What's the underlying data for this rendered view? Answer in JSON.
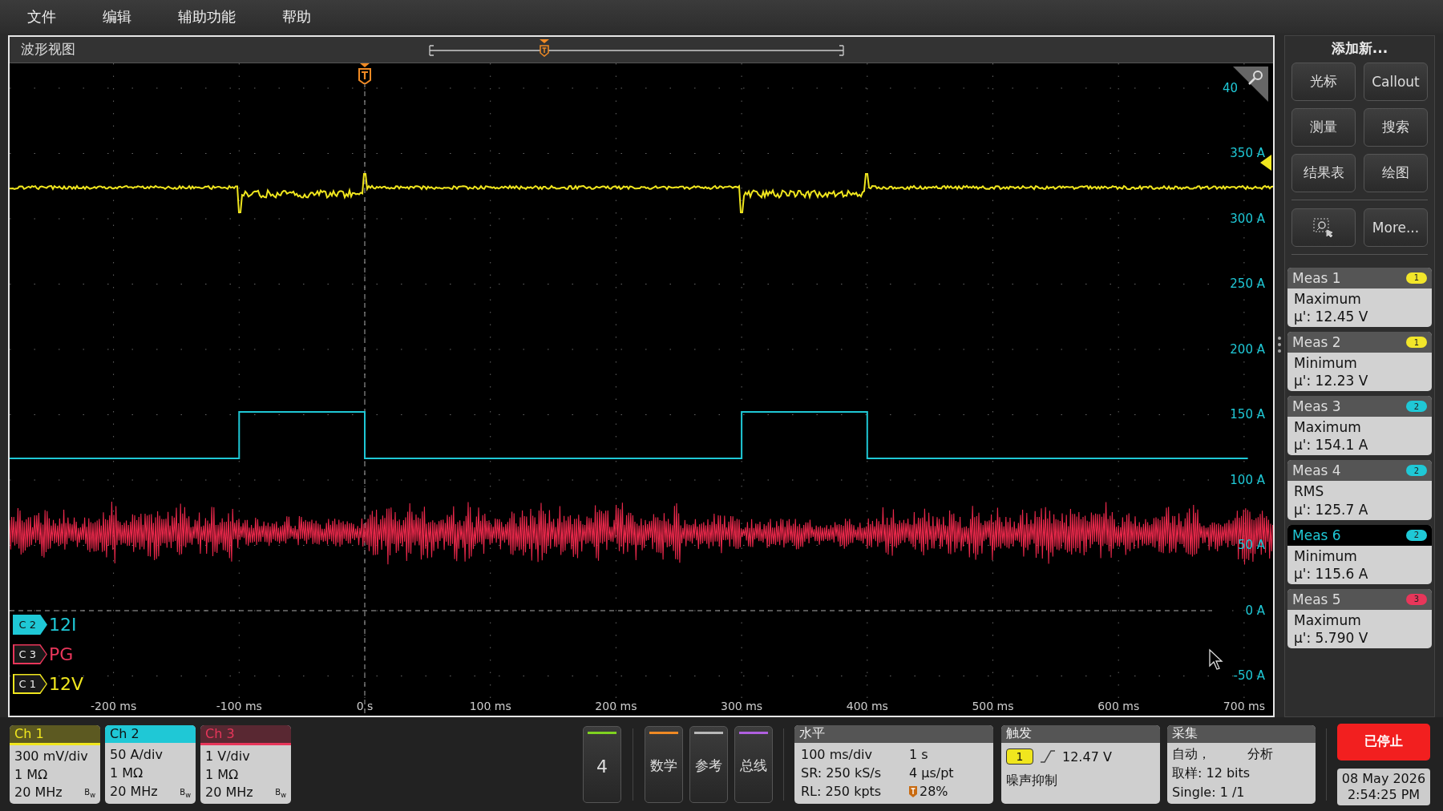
{
  "menu": [
    {
      "label": "文件"
    },
    {
      "label": "编辑"
    },
    {
      "label": "辅助功能"
    },
    {
      "label": "帮助"
    }
  ],
  "waveform_view": {
    "title": "波形视图",
    "y_labels": [
      "40",
      "350 A",
      "300 A",
      "250 A",
      "200 A",
      "150 A",
      "100 A",
      "50 A",
      "0 A",
      "-50 A"
    ],
    "x_labels": [
      "-200 ms",
      "-100 ms",
      "0 s",
      "100 ms",
      "200 ms",
      "300 ms",
      "400 ms",
      "500 ms",
      "600 ms",
      "700 ms"
    ],
    "channel_tags": [
      {
        "badge": "C 2",
        "name": "12I",
        "color": "#1fc8d6",
        "selected": true
      },
      {
        "badge": "C 3",
        "name": "PG",
        "color": "#e8365a",
        "selected": false
      },
      {
        "badge": "C 1",
        "name": "12V",
        "color": "#f0e61e",
        "selected": false
      }
    ]
  },
  "right_panel": {
    "title": "添加新...",
    "buttons": [
      {
        "kind": "text",
        "label": "光标"
      },
      {
        "kind": "text",
        "label": "Callout"
      },
      {
        "kind": "text",
        "label": "测量"
      },
      {
        "kind": "text",
        "label": "搜索"
      },
      {
        "kind": "text",
        "label": "结果表"
      },
      {
        "kind": "text",
        "label": "绘图"
      },
      {
        "kind": "icon"
      },
      {
        "kind": "text",
        "label": "More..."
      }
    ],
    "measurements": [
      {
        "title": "Meas 1",
        "source": "1",
        "color": "#f2e62a",
        "type": "Maximum",
        "value": "µ': 12.45 V",
        "selected": false
      },
      {
        "title": "Meas 2",
        "source": "1",
        "color": "#f2e62a",
        "type": "Minimum",
        "value": "µ': 12.23 V",
        "selected": false
      },
      {
        "title": "Meas 3",
        "source": "2",
        "color": "#1fc8d6",
        "type": "Maximum",
        "value": "µ': 154.1 A",
        "selected": false
      },
      {
        "title": "Meas 4",
        "source": "2",
        "color": "#1fc8d6",
        "type": "RMS",
        "value": "µ': 125.7 A",
        "selected": false
      },
      {
        "title": "Meas 6",
        "source": "2",
        "color": "#1fc8d6",
        "type": "Minimum",
        "value": "µ': 115.6 A",
        "selected": true
      },
      {
        "title": "Meas 5",
        "source": "3",
        "color": "#e8365a",
        "type": "Maximum",
        "value": "µ': 5.790 V",
        "selected": false
      }
    ]
  },
  "channels": [
    {
      "title": "Ch 1",
      "color": "#f0e61e",
      "selected": false,
      "lines": [
        "300 mV/div",
        "1 MΩ",
        "20 MHz"
      ],
      "bandwidth": "B$_{w}$"
    },
    {
      "title": "Ch 2",
      "color": "#1fc8d6",
      "selected": true,
      "lines": [
        "50 A/div",
        "1 MΩ",
        "20 MHz"
      ],
      "bandwidth": "B$_{w}$"
    },
    {
      "title": "Ch 3",
      "color": "#e8365a",
      "selected": false,
      "lines": [
        "1 V/div",
        "1 MΩ",
        "20 MHz"
      ],
      "bandwidth": "B$_{w}$"
    }
  ],
  "add_buttons": [
    {
      "label": "4",
      "color": "#7fd320"
    },
    {
      "label": "数学",
      "color": "#f08a24"
    },
    {
      "label": "参考",
      "color": "#b8b8b8"
    },
    {
      "label": "总线",
      "color": "#b060e0"
    }
  ],
  "horizontal": {
    "title": "水平",
    "items": [
      {
        "kind": "text",
        "text": "100 ms/div"
      },
      {
        "kind": "text",
        "text": "1 s"
      },
      {
        "kind": "text",
        "text": "SR: 250 kS/s"
      },
      {
        "kind": "text",
        "text": "4 µs/pt"
      },
      {
        "kind": "text",
        "text": "RL: 250 kpts"
      },
      {
        "kind": "position",
        "text": "28%"
      }
    ]
  },
  "trigger": {
    "title": "触发",
    "source": "1",
    "level": "12.47 V",
    "mode": "噪声抑制"
  },
  "acquisition": {
    "title": "采集",
    "mode": "自动，",
    "analysis": "分析",
    "resolution": "取样: 12 bits",
    "sequence": "Single: 1 /1"
  },
  "run_state": {
    "label": "已停止",
    "running": false
  },
  "clock": {
    "date": "08 May 2026",
    "time": "2:54:25 PM"
  }
}
